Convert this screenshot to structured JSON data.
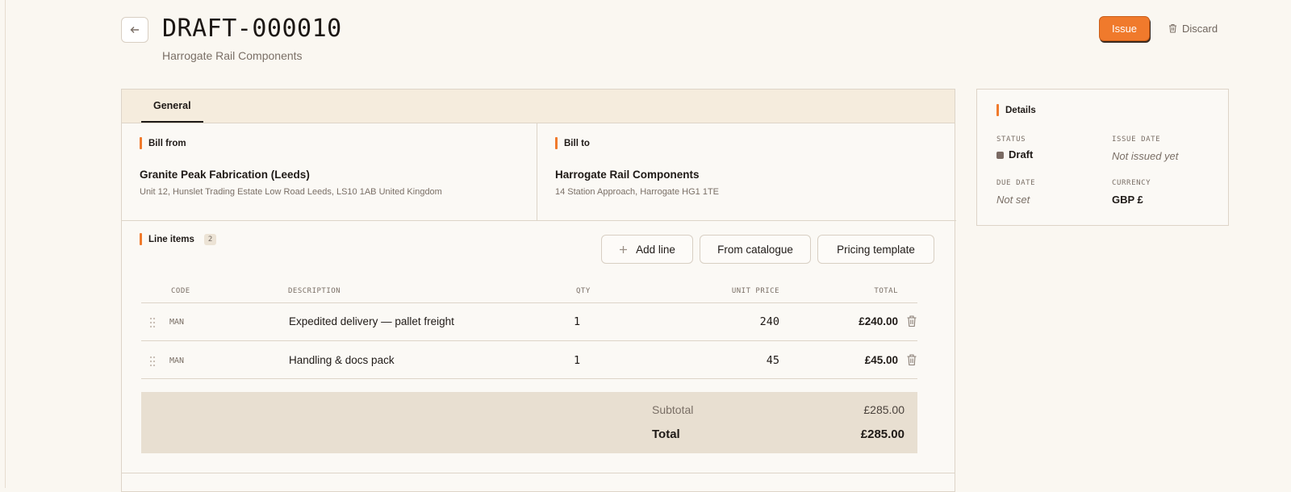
{
  "header": {
    "title": "DRAFT-000010",
    "subtitle": "Harrogate Rail Components",
    "issue_label": "Issue",
    "discard_label": "Discard"
  },
  "tabs": [
    {
      "label": "General",
      "active": true
    }
  ],
  "bill_from": {
    "label": "Bill from",
    "name": "Granite Peak Fabrication (Leeds)",
    "address": "Unit 12, Hunslet Trading Estate Low Road Leeds, LS10 1AB United Kingdom"
  },
  "bill_to": {
    "label": "Bill to",
    "name": "Harrogate Rail Components",
    "address": "14 Station Approach, Harrogate HG1 1TE"
  },
  "line_items": {
    "label": "Line items",
    "count": "2",
    "actions": {
      "add_line": "Add line",
      "from_catalogue": "From catalogue",
      "pricing_template": "Pricing template"
    },
    "columns": {
      "code": "CODE",
      "description": "DESCRIPTION",
      "qty": "QTY",
      "unit_price": "UNIT PRICE",
      "total": "TOTAL"
    },
    "rows": [
      {
        "code": "MAN",
        "description": "Expedited delivery — pallet freight",
        "qty": "1",
        "unit_price": "240",
        "total": "£240.00"
      },
      {
        "code": "MAN",
        "description": "Handling & docs pack",
        "qty": "1",
        "unit_price": "45",
        "total": "£45.00"
      }
    ],
    "subtotal_label": "Subtotal",
    "subtotal_value": "£285.00",
    "total_label": "Total",
    "total_value": "£285.00"
  },
  "details": {
    "title": "Details",
    "status_label": "STATUS",
    "status_value": "Draft",
    "issue_date_label": "ISSUE DATE",
    "issue_date_value": "Not issued yet",
    "due_date_label": "DUE DATE",
    "due_date_value": "Not set",
    "currency_label": "CURRENCY",
    "currency_value": "GBP £"
  },
  "colors": {
    "accent": "#f07a2c",
    "background": "#faf7f1",
    "tab_bar": "#f5ecdd",
    "totals_bg": "#e8dfd1",
    "status_draft": "#7a6a63"
  }
}
